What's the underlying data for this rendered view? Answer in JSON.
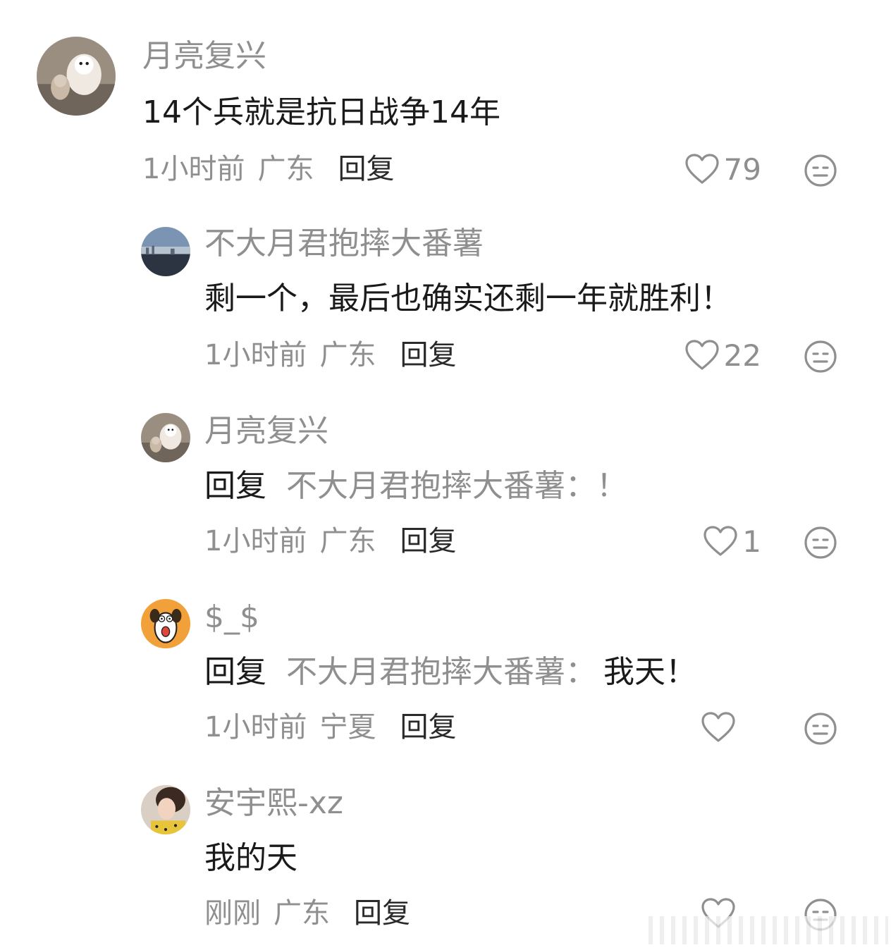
{
  "comments": [
    {
      "user": "月亮复兴",
      "text": "14个兵就是抗日战争14年",
      "time": "1小时前",
      "location": "广东",
      "reply_label": "回复",
      "likes": "79"
    },
    {
      "user": "不大月君抱摔大番薯",
      "text": "剩一个，最后也确实还剩一年就胜利！",
      "time": "1小时前",
      "location": "广东",
      "reply_label": "回复",
      "likes": "22"
    },
    {
      "user": "月亮复兴",
      "reply_prefix": "回复",
      "reply_to": "不大月君抱摔大番薯：！",
      "time": "1小时前",
      "location": "广东",
      "reply_label": "回复",
      "likes": "1"
    },
    {
      "user": "$_$",
      "reply_prefix": "回复",
      "reply_to": "不大月君抱摔大番薯：",
      "text": "我天！",
      "time": "1小时前",
      "location": "宁夏",
      "reply_label": "回复",
      "likes": ""
    },
    {
      "user": "安宇熙-xz",
      "text": "我的天",
      "time": "刚刚",
      "location": "广东",
      "reply_label": "回复",
      "likes": ""
    }
  ],
  "icons": {
    "like": "heart-outline-icon",
    "dislike": "neutral-face-icon",
    "color_gray": "#8f8f8f",
    "color_text": "#1a1a1a"
  }
}
